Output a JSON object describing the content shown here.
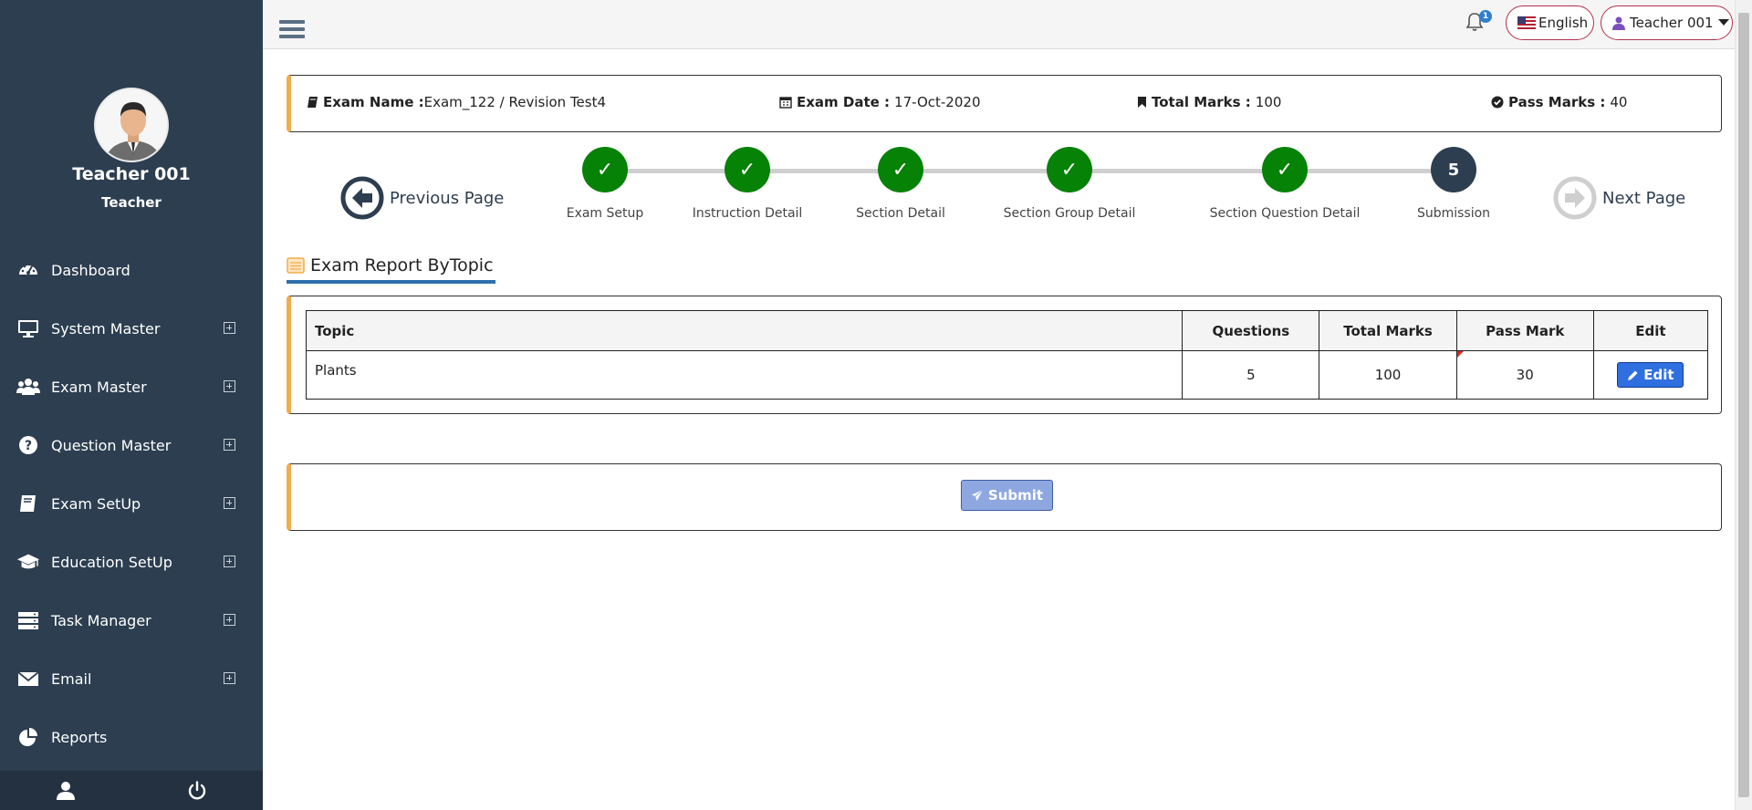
{
  "sidebar": {
    "profile_name": "Teacher 001",
    "profile_role": "Teacher",
    "items": [
      {
        "label": "Dashboard",
        "icon": "dashboard-icon",
        "expandable": false
      },
      {
        "label": "System Master",
        "icon": "monitor-icon",
        "expandable": true
      },
      {
        "label": "Exam Master",
        "icon": "users-icon",
        "expandable": true
      },
      {
        "label": "Question Master",
        "icon": "question-icon",
        "expandable": true
      },
      {
        "label": "Exam SetUp",
        "icon": "book-icon",
        "expandable": true
      },
      {
        "label": "Education SetUp",
        "icon": "graduation-cap-icon",
        "expandable": true
      },
      {
        "label": "Task Manager",
        "icon": "server-icon",
        "expandable": true
      },
      {
        "label": "Email",
        "icon": "envelope-icon",
        "expandable": true
      },
      {
        "label": "Reports",
        "icon": "pie-chart-icon",
        "expandable": false
      }
    ],
    "footer": {
      "profile_icon": "user-icon",
      "logout_icon": "power-icon"
    }
  },
  "topbar": {
    "notification_count": "1",
    "language": "English",
    "user": "Teacher 001"
  },
  "exam_info": {
    "name_label": "Exam Name :",
    "name_value": "Exam_122 / Revision Test4",
    "date_label": "Exam Date :",
    "date_value": "17-Oct-2020",
    "total_label": "Total Marks :",
    "total_value": "100",
    "pass_label": "Pass Marks :",
    "pass_value": "40"
  },
  "wizard": {
    "prev_label": "Previous Page",
    "next_label": "Next Page",
    "steps": [
      {
        "label": "Exam Setup",
        "status": "done",
        "mark": "✓"
      },
      {
        "label": "Instruction Detail",
        "status": "done",
        "mark": "✓"
      },
      {
        "label": "Section Detail",
        "status": "done",
        "mark": "✓"
      },
      {
        "label": "Section Group Detail",
        "status": "done",
        "mark": "✓"
      },
      {
        "label": "Section Question Detail",
        "status": "done",
        "mark": "✓"
      },
      {
        "label": "Submission",
        "status": "current",
        "mark": "5"
      }
    ]
  },
  "report": {
    "title": "Exam Report ByTopic",
    "columns": [
      "Topic",
      "Questions",
      "Total Marks",
      "Pass Mark",
      "Edit"
    ],
    "rows": [
      {
        "topic": "Plants",
        "questions": "5",
        "total_marks": "100",
        "pass_mark": "30",
        "edit_label": "Edit"
      }
    ]
  },
  "submit_label": "Submit",
  "colors": {
    "sidebar_bg": "#2c3e50",
    "accent_border": "#f0ad4e",
    "step_done": "#068206",
    "step_current": "#2c3e50",
    "edit_button": "#2f6fe0",
    "submit_button": "#8ea7e0"
  }
}
